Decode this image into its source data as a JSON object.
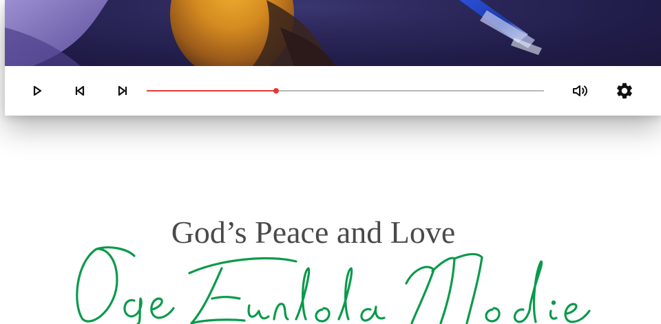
{
  "player": {
    "progress_fraction": 0.325,
    "accent_color": "#e53935",
    "track_color": "#b8b8b8",
    "controls": {
      "play": {
        "icon": "play-icon"
      },
      "previous": {
        "icon": "skip-previous-icon"
      },
      "next": {
        "icon": "skip-next-icon"
      },
      "volume": {
        "icon": "volume-icon"
      },
      "settings": {
        "icon": "gear-icon"
      }
    }
  },
  "content": {
    "subtitle": "God’s Peace and Love",
    "signature_name": "Oge Funlola Modie",
    "signature_color": "#0a9a4a",
    "subtitle_color": "#4a4a4a"
  }
}
